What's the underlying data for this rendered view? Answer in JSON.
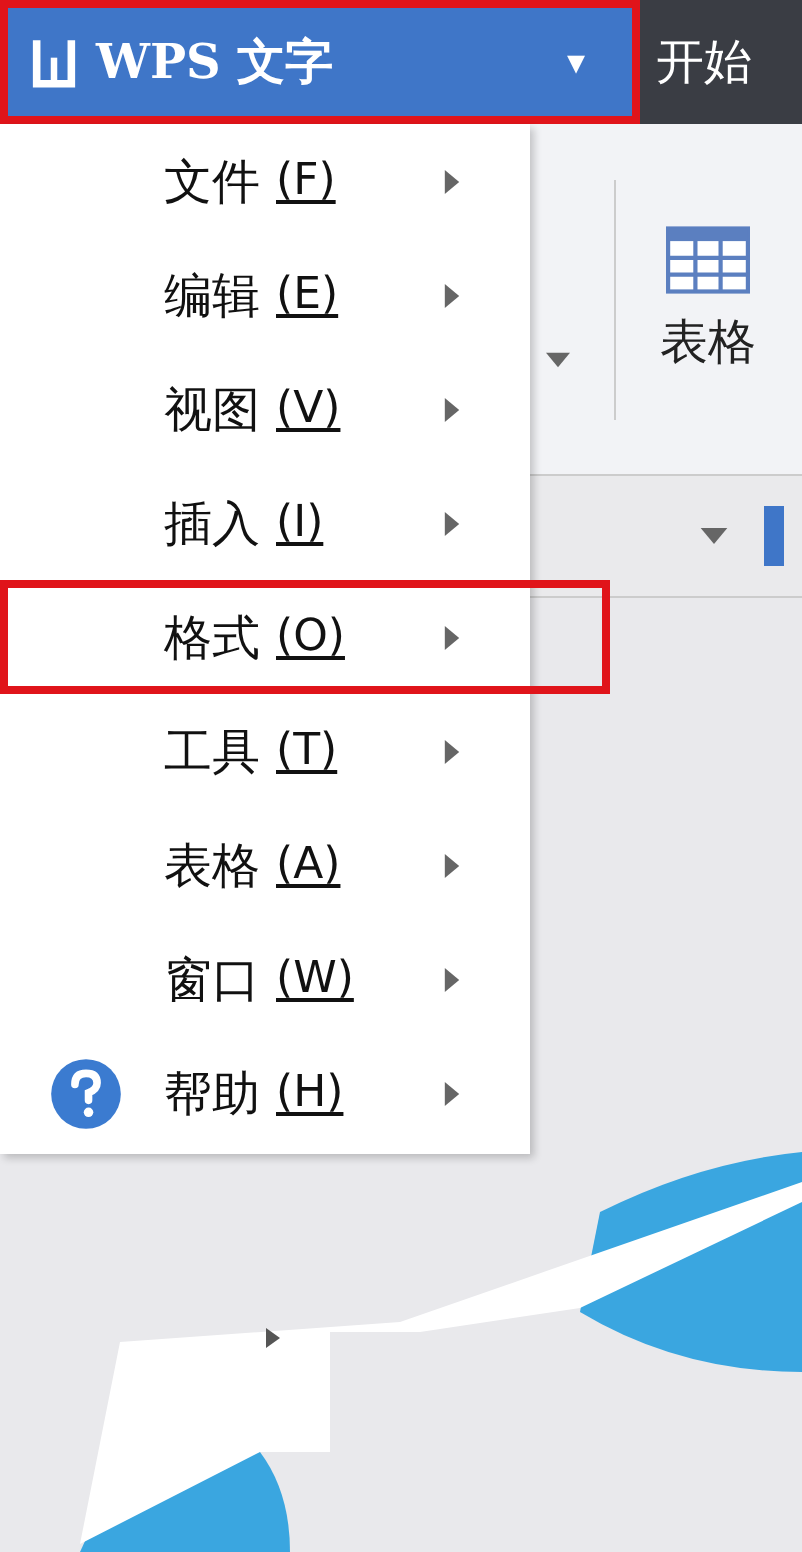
{
  "app_button": {
    "title": "WPS 文字",
    "caret": "▾",
    "highlighted": true
  },
  "ribbon_tabs": [
    {
      "label": "开始"
    }
  ],
  "ribbon": {
    "table_label": "表格"
  },
  "menu": [
    {
      "label": "文件",
      "key": "(F)",
      "highlighted": false,
      "kind": "plain"
    },
    {
      "label": "编辑",
      "key": "(E)",
      "highlighted": false,
      "kind": "plain"
    },
    {
      "label": "视图",
      "key": "(V)",
      "highlighted": false,
      "kind": "plain"
    },
    {
      "label": "插入",
      "key": "(I)",
      "highlighted": false,
      "kind": "plain"
    },
    {
      "label": "格式",
      "key": "(O)",
      "highlighted": true,
      "kind": "plain"
    },
    {
      "label": "工具",
      "key": "(T)",
      "highlighted": false,
      "kind": "plain"
    },
    {
      "label": "表格",
      "key": "(A)",
      "highlighted": false,
      "kind": "plain"
    },
    {
      "label": "窗口",
      "key": "(W)",
      "highlighted": false,
      "kind": "plain"
    },
    {
      "label": "帮助",
      "key": "(H)",
      "highlighted": false,
      "kind": "help"
    }
  ]
}
